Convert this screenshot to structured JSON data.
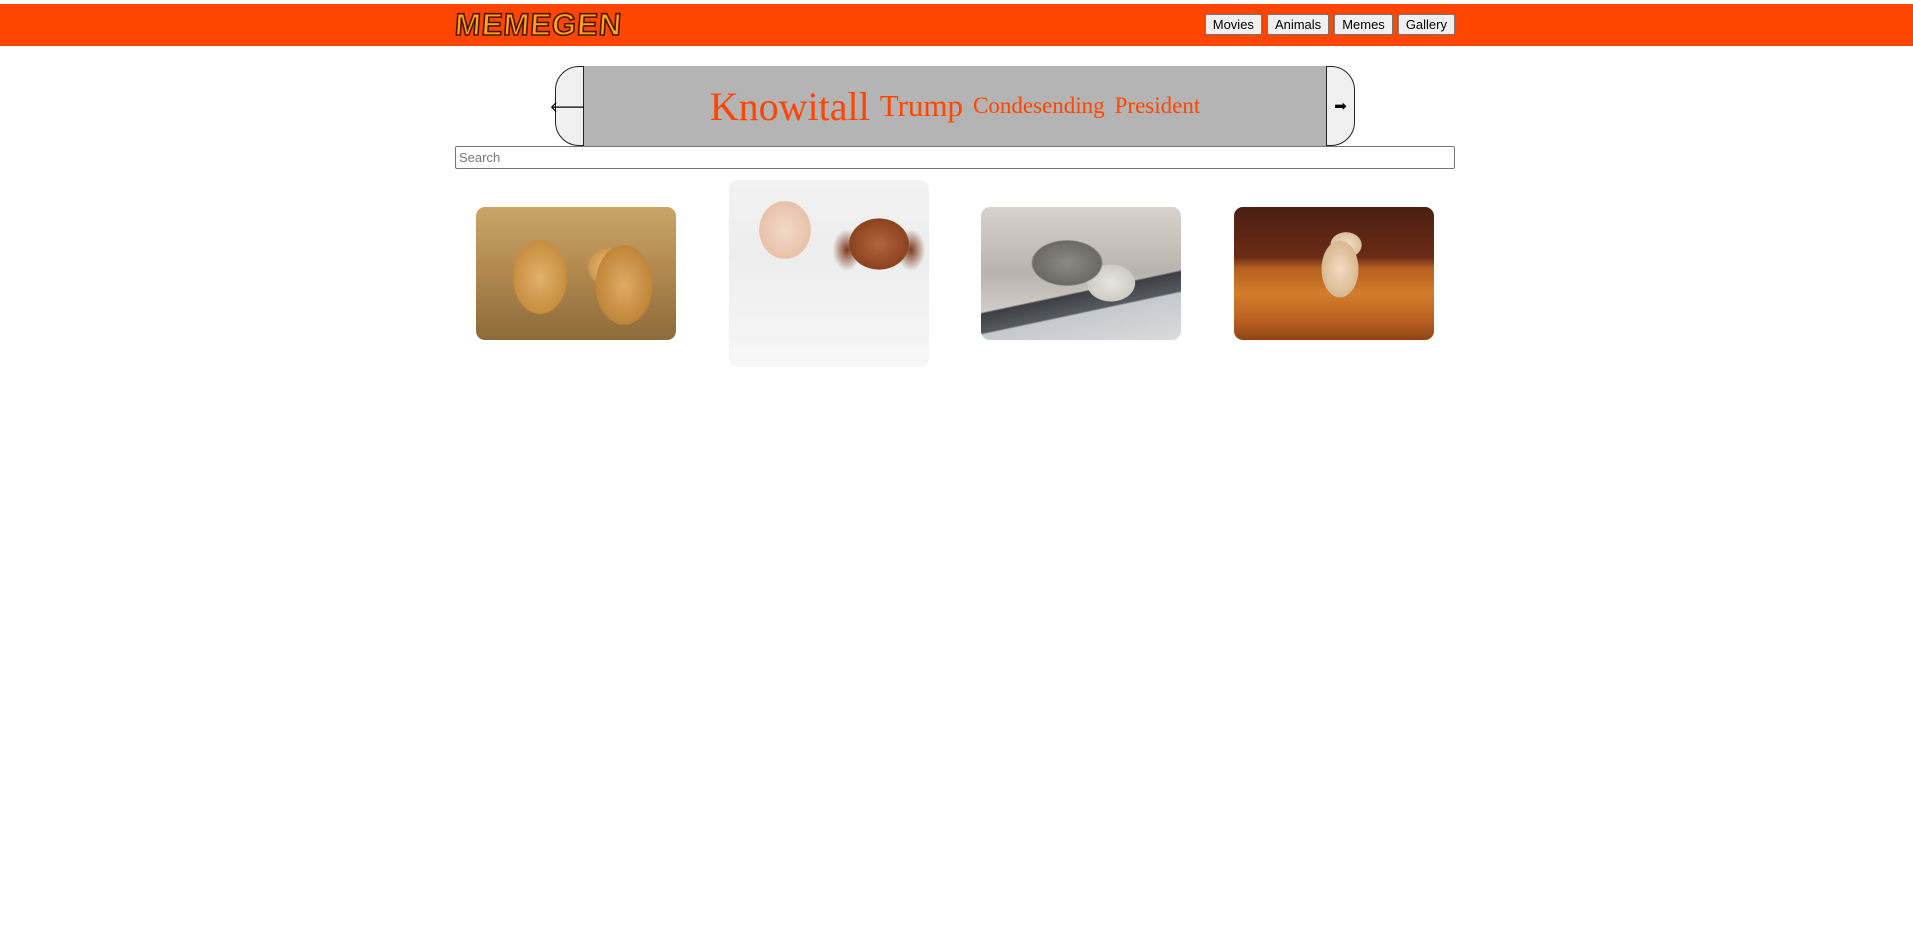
{
  "header": {
    "logo_text": "MEMEGEN",
    "background_color": "#ff4500",
    "nav": [
      {
        "label": "Movies"
      },
      {
        "label": "Animals"
      },
      {
        "label": "Memes"
      },
      {
        "label": "Gallery"
      }
    ]
  },
  "keyword_carousel": {
    "prev_icon": "arrow-left-icon",
    "next_icon": "arrow-right-icon",
    "prev_glyph": "🡐",
    "next_glyph": "➡",
    "keyword_color": "#ff4500",
    "bar_color": "#b4b4b4",
    "keywords": [
      {
        "label": "Knowitall"
      },
      {
        "label": "Trump"
      },
      {
        "label": "Condesending"
      },
      {
        "label": "President"
      }
    ]
  },
  "search": {
    "placeholder": "Search",
    "value": ""
  },
  "gallery": {
    "images": [
      {
        "subject": "two golden retriever puppies"
      },
      {
        "subject": "sleeping baby with dachshund puppy"
      },
      {
        "subject": "cat sleeping on laptop keyboard"
      },
      {
        "subject": "chihuahua stretching on wooden floor"
      }
    ]
  }
}
